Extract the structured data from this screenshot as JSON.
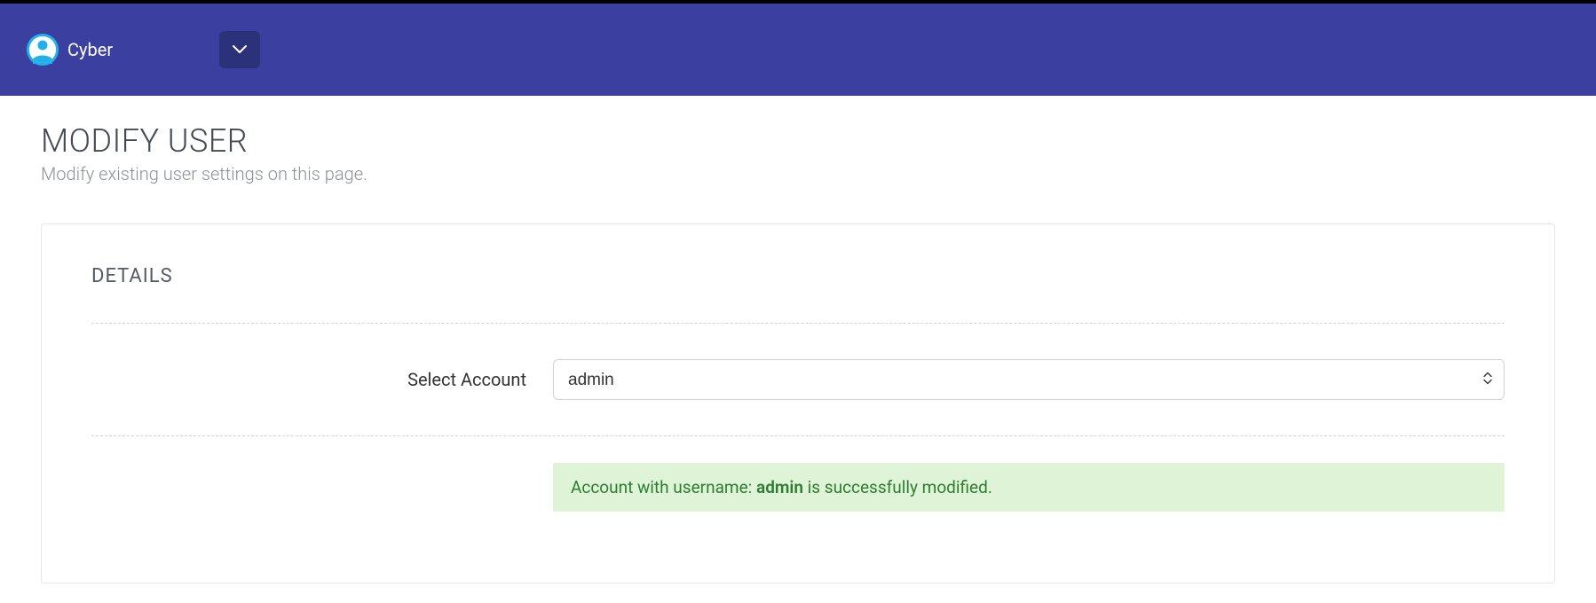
{
  "header": {
    "username": "Cyber"
  },
  "page": {
    "title": "MODIFY USER",
    "subtitle": "Modify existing user settings on this page."
  },
  "panel": {
    "title": "DETAILS",
    "select_label": "Select Account",
    "select_value": "admin"
  },
  "alert": {
    "prefix": "Account with username: ",
    "username": "admin",
    "suffix": " is successfully modified."
  }
}
